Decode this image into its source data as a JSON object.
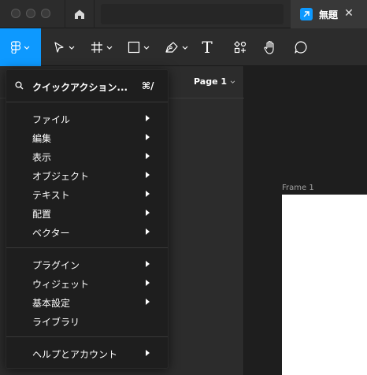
{
  "titlebar": {
    "file_tab_title": "無題",
    "close_symbol": "✕"
  },
  "toolbar": {
    "tools": [
      "main-menu",
      "move",
      "frame",
      "shape",
      "pen",
      "text",
      "resources",
      "hand",
      "comment"
    ],
    "text_tool_glyph": "T"
  },
  "left_panel": {
    "page_label": "Page 1"
  },
  "canvas": {
    "frame_label": "Frame 1"
  },
  "menu": {
    "quick_action": "クイックアクション...",
    "quick_action_shortcut": "⌘/",
    "group1": [
      {
        "label": "ファイル"
      },
      {
        "label": "編集"
      },
      {
        "label": "表示"
      },
      {
        "label": "オブジェクト"
      },
      {
        "label": "テキスト"
      },
      {
        "label": "配置"
      },
      {
        "label": "ベクター"
      }
    ],
    "group2": [
      {
        "label": "プラグイン"
      },
      {
        "label": "ウィジェット"
      },
      {
        "label": "基本設定"
      },
      {
        "label": "ライブラリ"
      }
    ],
    "group3": [
      {
        "label": "ヘルプとアカウント"
      }
    ]
  },
  "colors": {
    "accent": "#0d99ff",
    "toolbar_bg": "#2c2c2c",
    "menu_bg": "#1e1e1e",
    "canvas_bg": "#1e1e1e"
  }
}
